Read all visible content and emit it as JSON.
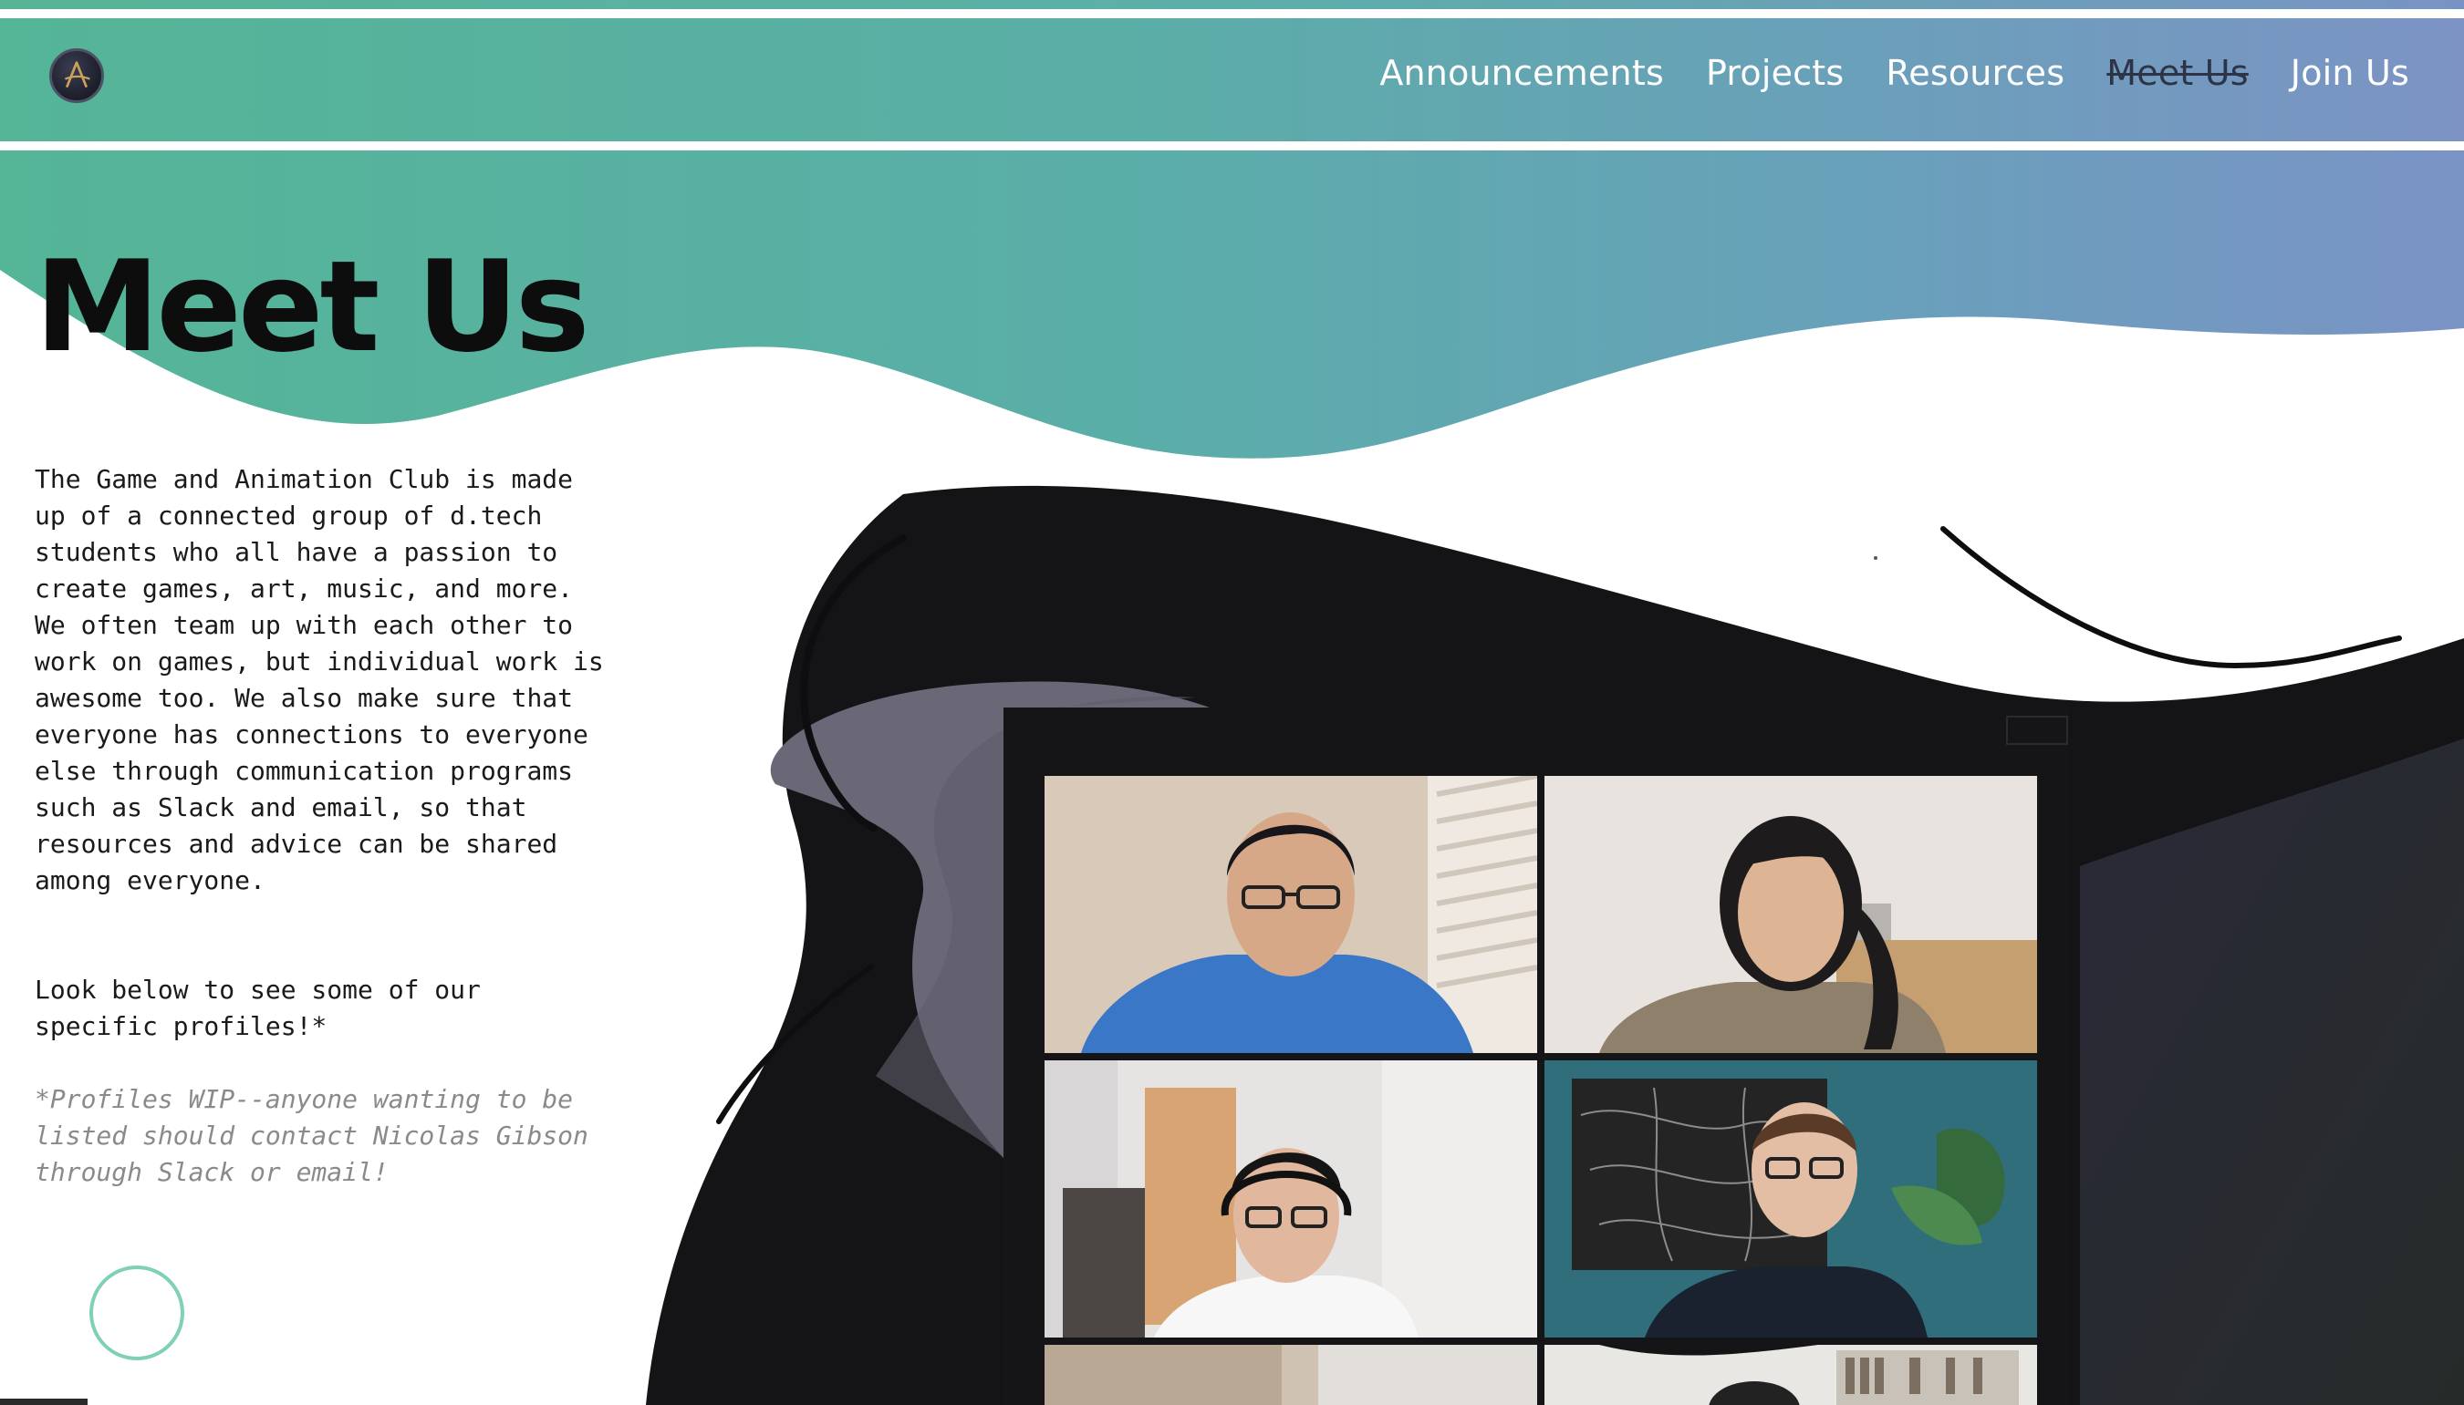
{
  "nav": {
    "logo_icon": "club-logo-icon",
    "items": [
      {
        "label": "Announcements",
        "current": false
      },
      {
        "label": "Projects",
        "current": false
      },
      {
        "label": "Resources",
        "current": false
      },
      {
        "label": "Meet Us",
        "current": true
      },
      {
        "label": "Join Us",
        "current": false
      }
    ]
  },
  "page": {
    "title": "Meet Us",
    "intro": "The Game and Animation Club is made up of a connected group of d.tech students who all have a passion to create games, art, music, and more. We often team up with each other to work on games, but individual work is awesome too. We also make sure that everyone has connections to everyone else through communication programs such as Slack and email, so that resources and advice can be shared among everyone.",
    "cta": "Look below to see some of our specific profiles!*",
    "note": "*Profiles WIP--anyone wanting to be listed should contact Nicolas Gibson through Slack or email!"
  },
  "photo_grid": {
    "tiles": [
      {
        "name": "member-photo-1",
        "icon": "person-photo"
      },
      {
        "name": "member-photo-2",
        "icon": "person-photo"
      },
      {
        "name": "member-photo-3",
        "icon": "person-photo"
      },
      {
        "name": "member-photo-4",
        "icon": "person-photo"
      },
      {
        "name": "member-photo-5",
        "icon": "person-photo"
      },
      {
        "name": "member-photo-6",
        "icon": "person-photo"
      }
    ]
  },
  "colors": {
    "gradient_start": "#55b597",
    "gradient_end": "#7c93c4",
    "dark_shape": "#141416",
    "accent_circle": "#7fd1b2",
    "current_nav": "#2d3447"
  }
}
